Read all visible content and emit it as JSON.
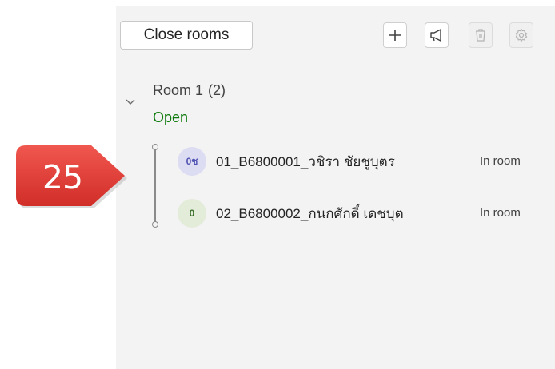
{
  "toolbar": {
    "close_rooms_label": "Close rooms",
    "icons": [
      "plus-icon",
      "announcement-icon",
      "trash-icon",
      "settings-icon"
    ]
  },
  "room": {
    "name": "Room 1",
    "count": "(2)",
    "status": "Open"
  },
  "participants": [
    {
      "initials": "0ช",
      "name": "01_B6800001_วชิรา ชัยชูบุตร",
      "status": "In room",
      "avatar_bg": "#dcdcf2",
      "avatar_fg": "#4f52b2"
    },
    {
      "initials": "0",
      "name": "02_B6800002_กนกศักดิ์ เดชบุต",
      "status": "In room",
      "avatar_bg": "#e3ecd9",
      "avatar_fg": "#3a6e2a"
    }
  ],
  "callout": {
    "number": "25",
    "color": "#e8403a"
  },
  "colors": {
    "open_status": "#0e7a0d",
    "panel_bg": "#f3f3f3"
  }
}
